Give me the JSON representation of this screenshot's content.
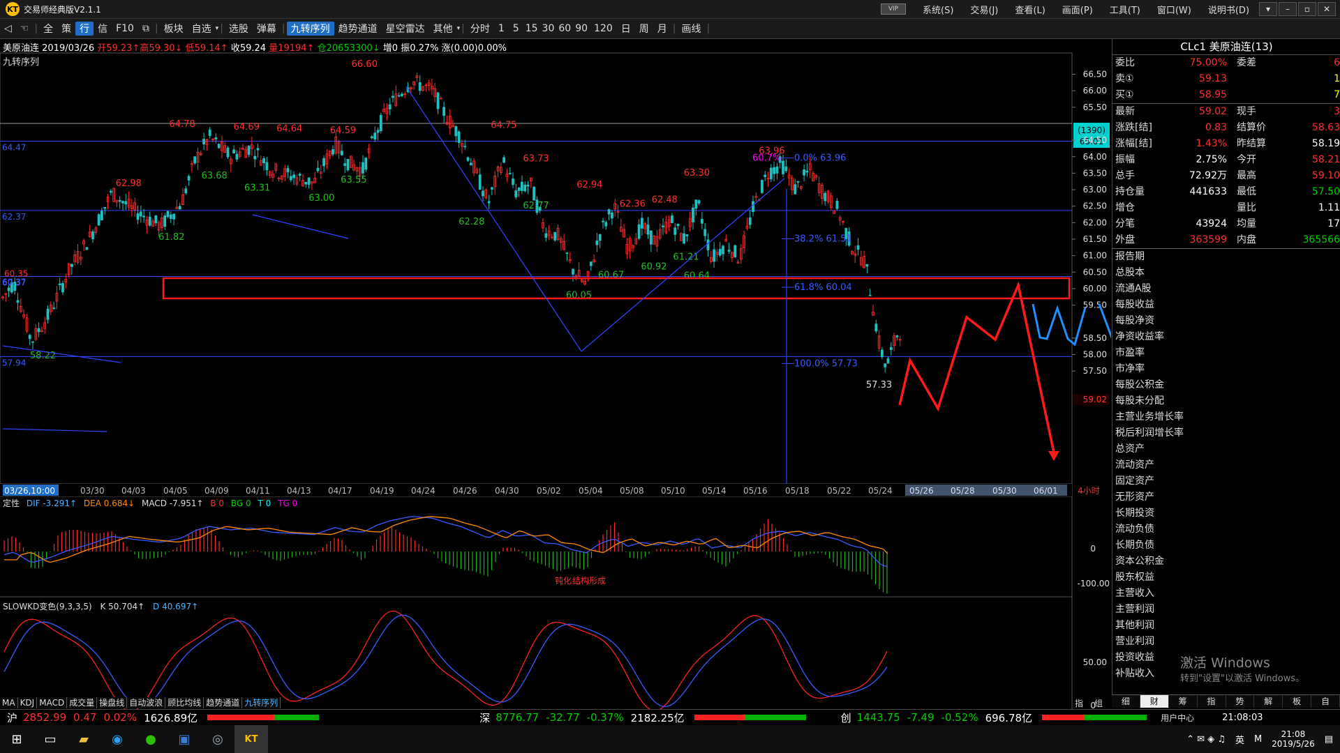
{
  "app": {
    "title": "交易师经典版V2.1.1",
    "logo": "KT",
    "vip": "VIP"
  },
  "menus": [
    "系统(S)",
    "交易(J)",
    "查看(L)",
    "画面(P)",
    "工具(T)",
    "窗口(W)",
    "说明书(D)"
  ],
  "toolbar": {
    "items": [
      "全",
      "策",
      "行",
      "信",
      "F10",
      "板块",
      "自选",
      "选股",
      "弹幕",
      "九转序列",
      "趋势通道",
      "星空雷达",
      "其他",
      "分时",
      "1",
      "5",
      "15",
      "30",
      "60",
      "90",
      "120",
      "日",
      "周",
      "月",
      "画线"
    ],
    "active": "九转序列"
  },
  "info": {
    "name": "美原油连",
    "date": "2019/03/26",
    "open": "开59.23↑",
    "high": "高59.30↓",
    "low": "低59.14↑",
    "close": "收59.24",
    "volume": "量19194↑",
    "oi": "仓20653300↓",
    "extra": "增0 振0.27% 涨(0.00)0.00%",
    "indicator": "九转序列"
  },
  "price_axis": [
    "66.50",
    "66.00",
    "65.50",
    "65.01",
    "64.50",
    "64.00",
    "63.50",
    "63.00",
    "62.50",
    "62.00",
    "61.50",
    "61.00",
    "60.50",
    "60.00",
    "59.50",
    "59.02",
    "58.50",
    "58.00",
    "57.50"
  ],
  "price_tag": {
    "top": "(1390)",
    "bottom": "65.01",
    "current": "59.02"
  },
  "levels": [
    {
      "label": "64.47",
      "price": 64.47
    },
    {
      "label": "62.37",
      "price": 62.37
    },
    {
      "label": "60.37",
      "price": 60.37
    },
    {
      "label": "57.94",
      "price": 57.94
    }
  ],
  "peak_labels": [
    {
      "t": "66.60",
      "x": 0.34,
      "y": 66.6
    },
    {
      "t": "64.78",
      "x": 0.17,
      "y": 64.78
    },
    {
      "t": "64.69",
      "x": 0.23,
      "y": 64.69
    },
    {
      "t": "64.64",
      "x": 0.27,
      "y": 64.64
    },
    {
      "t": "64.59",
      "x": 0.32,
      "y": 64.59
    },
    {
      "t": "64.75",
      "x": 0.47,
      "y": 64.75
    },
    {
      "t": "62.98",
      "x": 0.12,
      "y": 62.98
    },
    {
      "t": "63.73",
      "x": 0.5,
      "y": 63.73
    },
    {
      "t": "62.94",
      "x": 0.55,
      "y": 62.94
    },
    {
      "t": "62.36",
      "x": 0.59,
      "y": 62.36
    },
    {
      "t": "62.48",
      "x": 0.62,
      "y": 62.48
    },
    {
      "t": "63.30",
      "x": 0.65,
      "y": 63.3
    },
    {
      "t": "63.96",
      "x": 0.72,
      "y": 63.96
    }
  ],
  "trough_labels": [
    {
      "t": "63.68",
      "x": 0.2,
      "y": 63.68
    },
    {
      "t": "63.31",
      "x": 0.24,
      "y": 63.31
    },
    {
      "t": "63.00",
      "x": 0.3,
      "y": 63.0
    },
    {
      "t": "63.55",
      "x": 0.33,
      "y": 63.55
    },
    {
      "t": "62.28",
      "x": 0.44,
      "y": 62.28
    },
    {
      "t": "62.77",
      "x": 0.5,
      "y": 62.77
    },
    {
      "t": "61.82",
      "x": 0.16,
      "y": 61.82
    },
    {
      "t": "60.05",
      "x": 0.54,
      "y": 60.05
    },
    {
      "t": "60.67",
      "x": 0.57,
      "y": 60.67
    },
    {
      "t": "60.92",
      "x": 0.61,
      "y": 60.92
    },
    {
      "t": "61.21",
      "x": 0.64,
      "y": 61.21
    },
    {
      "t": "60.64",
      "x": 0.65,
      "y": 60.64
    },
    {
      "t": "58.22",
      "x": 0.04,
      "y": 58.22
    },
    {
      "t": "57.33",
      "x": 0.82,
      "y": 57.33
    }
  ],
  "fib": [
    {
      "t": "0.0% 63.96",
      "y": 63.96
    },
    {
      "t": "38.2% 61.51",
      "y": 61.51
    },
    {
      "t": "61.8% 60.04",
      "y": 60.04
    },
    {
      "t": "100.0% 57.73",
      "y": 57.73
    }
  ],
  "fib_extra": "60.7%",
  "left_labels": [
    "60.35",
    "60.37"
  ],
  "date_axis": [
    "03/26,10:00",
    "03/30",
    "04/03",
    "04/05",
    "04/09",
    "04/11",
    "04/13",
    "04/17",
    "04/19",
    "04/24",
    "04/26",
    "04/30",
    "05/02",
    "05/04",
    "05/08",
    "05/10",
    "05/14",
    "05/16",
    "05/18",
    "05/22",
    "05/24",
    "05/26",
    "05/28",
    "05/30",
    "06/01"
  ],
  "date_axis_right": "4小时",
  "macd": {
    "name": "定性",
    "dif": "DIF -3.291↑",
    "dea": "DEA 0.684↓",
    "macd": "MACD -7.951↑",
    "b": "B 0",
    "bg": "BG 0",
    "t": "T 0",
    "tg": "TG 0",
    "axis": [
      "0",
      "-100.00"
    ],
    "signals": [
      "钝化",
      "结构形成"
    ]
  },
  "kd": {
    "name": "SLOWKD变色(9,3,3,5)",
    "k": "K 50.704↑",
    "d": "D 40.697↑",
    "axis": [
      "50.00",
      "0"
    ]
  },
  "right_panel": {
    "title": "CLc1 美原油连(13)",
    "quotes": [
      {
        "l1": "委比",
        "v1": "75.00%",
        "c1": "red",
        "l2": "委差",
        "v2": "6",
        "c2": "red"
      },
      {
        "l1": "卖①",
        "v1": "59.13",
        "c1": "red",
        "l2": "",
        "v2": "1",
        "c2": "yellow"
      },
      {
        "l1": "买①",
        "v1": "58.95",
        "c1": "red",
        "l2": "",
        "v2": "7",
        "c2": "yellow"
      }
    ],
    "stats": [
      {
        "l1": "最新",
        "v1": "59.02",
        "c1": "red",
        "l2": "现手",
        "v2": "3",
        "c2": "red"
      },
      {
        "l1": "涨跌[结]",
        "v1": "0.83",
        "c1": "red",
        "l2": "结算价",
        "v2": "58.63",
        "c2": "red"
      },
      {
        "l1": "涨幅[结]",
        "v1": "1.43%",
        "c1": "red",
        "l2": "昨结算",
        "v2": "58.19",
        "c2": "white"
      },
      {
        "l1": "振幅",
        "v1": "2.75%",
        "c1": "white",
        "l2": "今开",
        "v2": "58.21",
        "c2": "red"
      },
      {
        "l1": "总手",
        "v1": "72.92万",
        "c1": "white",
        "l2": "最高",
        "v2": "59.10",
        "c2": "red"
      },
      {
        "l1": "持仓量",
        "v1": "441633",
        "c1": "white",
        "l2": "最低",
        "v2": "57.50",
        "c2": "green"
      },
      {
        "l1": "增仓",
        "v1": "",
        "c1": "white",
        "l2": "量比",
        "v2": "1.11",
        "c2": "white"
      },
      {
        "l1": "分笔",
        "v1": "43924",
        "c1": "white",
        "l2": "均量",
        "v2": "17",
        "c2": "white"
      },
      {
        "l1": "外盘",
        "v1": "363599",
        "c1": "red",
        "l2": "内盘",
        "v2": "365566",
        "c2": "green"
      }
    ],
    "fin": [
      "报告期",
      "总股本",
      "流通A股",
      "每股收益",
      "每股净资",
      "净资收益率",
      "市盈率",
      "市净率",
      "每股公积金",
      "每股未分配",
      "主营业务增长率",
      "税后利润增长率",
      "总资产",
      "流动资产",
      "固定资产",
      "无形资产",
      "长期投资",
      "流动负债",
      "长期负债",
      "资本公积金",
      "股东权益",
      "主营收入",
      "主营利润",
      "其他利润",
      "营业利润",
      "投资收益",
      "补贴收入"
    ],
    "tabs": [
      "细",
      "财",
      "筹",
      "指",
      "势",
      "解",
      "板",
      "自"
    ],
    "selected_tab": "财",
    "watermark1": "激活 Windows",
    "watermark2": "转到\"设置\"以激活 Windows。"
  },
  "bottom_tabs": [
    "MA",
    "KDJ",
    "MACD",
    "成交量",
    "操盘线",
    "自动波浪",
    "顾比均线",
    "趋势通道",
    "九转序列"
  ],
  "bottom_tab_selected": "九转序列",
  "bottom_right_labels": [
    "指",
    "组"
  ],
  "status": {
    "sh": {
      "label": "沪",
      "price": "2852.99",
      "chg": "0.47",
      "pct": "0.02%",
      "amt": "1626.89亿"
    },
    "sz": {
      "label": "深",
      "price": "8776.77",
      "chg": "-32.77",
      "pct": "-0.37%",
      "amt": "2182.25亿"
    },
    "cy": {
      "label": "创",
      "price": "1443.75",
      "chg": "-7.49",
      "pct": "-0.52%",
      "amt": "696.78亿"
    },
    "user": "用户中心",
    "time": "21:08:03"
  },
  "taskbar": {
    "time": "21:08",
    "date": "2019/5/26",
    "ime": "英",
    "ime2": "M"
  }
}
